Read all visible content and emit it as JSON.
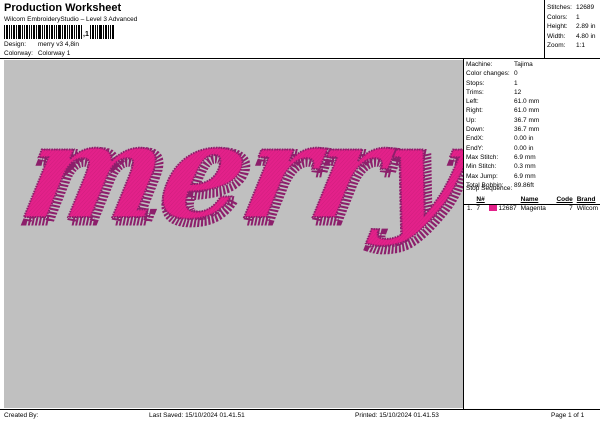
{
  "header": {
    "title": "Production Worksheet",
    "subtitle": "Wilcom EmbroideryStudio – Level 3 Advanced",
    "barcode_mark": ",1",
    "design_label": "Design:",
    "design_value": "merry v3 4,8in",
    "colorway_label": "Colorway:",
    "colorway_value": "Colorway 1"
  },
  "summary": [
    {
      "label": "Stitches:",
      "value": "12689"
    },
    {
      "label": "Colors:",
      "value": "1"
    },
    {
      "label": "Height:",
      "value": "2.89 in"
    },
    {
      "label": "Width:",
      "value": "4.80 in"
    },
    {
      "label": "Zoom:",
      "value": "1:1"
    }
  ],
  "design": {
    "artwork_text": "merry",
    "background_color": "#c0c0c0",
    "thread_color": "#e3218a",
    "edge_color": "#8c1f6b"
  },
  "machine_info": [
    {
      "label": "Machine:",
      "value": "Tajima"
    },
    {
      "label": "Color changes:",
      "value": "0"
    },
    {
      "label": "Stops:",
      "value": "1"
    },
    {
      "label": "Trims:",
      "value": "12"
    },
    {
      "label": "Left:",
      "value": "61.0 mm"
    },
    {
      "label": "Right:",
      "value": "61.0 mm"
    },
    {
      "label": "Up:",
      "value": "36.7 mm"
    },
    {
      "label": "Down:",
      "value": "36.7 mm"
    },
    {
      "label": "EndX:",
      "value": "0.00 in"
    },
    {
      "label": "EndY:",
      "value": "0.00 in"
    },
    {
      "label": "Max Stitch:",
      "value": "6.9 mm"
    },
    {
      "label": "Min Stitch:",
      "value": "0.3 mm"
    },
    {
      "label": "Max Jump:",
      "value": "6.9 mm"
    },
    {
      "label": "Total Bobbin:",
      "value": "89.86ft"
    }
  ],
  "stop_sequence": {
    "title": "Stop Sequence:",
    "columns": [
      "",
      "N#",
      "",
      "Name",
      "Code",
      "Brand"
    ],
    "rows": [
      {
        "index": "1.",
        "needle": "7",
        "swatch": "#e3218a",
        "stitches": "12687",
        "name": "Magenta",
        "code": "7",
        "brand": "Wilcom"
      }
    ]
  },
  "footer": {
    "created": "Created By:",
    "saved": "Last Saved: 15/10/2024 01.41.51",
    "printed": "Printed: 15/10/2024 01.41.53",
    "page": "Page 1 of 1"
  }
}
